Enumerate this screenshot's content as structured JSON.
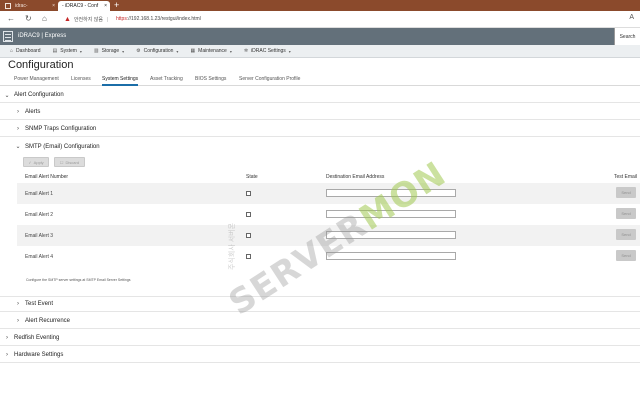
{
  "browser": {
    "tabs": [
      {
        "label": "idrac-",
        "close": "×"
      },
      {
        "label": "- iDRAC9 - Conf",
        "close": "×"
      }
    ],
    "new_tab": "+",
    "nav_icons": {
      "back": "←",
      "refresh": "↻",
      "home": "⌂"
    },
    "security_text": "안전하지 않음",
    "url_scheme": "https",
    "url_rest": "://192.168.1.23/restgui/index.html",
    "read_aloud": "A"
  },
  "idrac": {
    "product": "iDRAC9 | Express",
    "search_label": "Search",
    "nav": [
      {
        "label": "Dashboard",
        "icon": "home-icon",
        "glyph": "⌂",
        "dropdown": false
      },
      {
        "label": "System",
        "icon": "server-icon",
        "glyph": "▤",
        "dropdown": true
      },
      {
        "label": "Storage",
        "icon": "storage-icon",
        "glyph": "▥",
        "dropdown": true
      },
      {
        "label": "Configuration",
        "icon": "configuration-icon",
        "glyph": "⚙",
        "dropdown": true
      },
      {
        "label": "Maintenance",
        "icon": "maintenance-icon",
        "glyph": "▦",
        "dropdown": true
      },
      {
        "label": "iDRAC Settings",
        "icon": "settings-icon",
        "glyph": "✲",
        "dropdown": true
      }
    ]
  },
  "page": {
    "title": "Configuration",
    "subtabs": [
      {
        "label": "Power Management",
        "active": false
      },
      {
        "label": "Licenses",
        "active": false
      },
      {
        "label": "System Settings",
        "active": true
      },
      {
        "label": "Asset Tracking",
        "active": false
      },
      {
        "label": "BIOS Settings",
        "active": false
      },
      {
        "label": "Server Configuration Profile",
        "active": false
      }
    ]
  },
  "sections": {
    "alert_configuration": "Alert Configuration",
    "alerts": "Alerts",
    "snmp_traps": "SNMP Traps Configuration",
    "smtp": "SMTP (Email) Configuration",
    "test_event": "Test Event",
    "alert_recurrence": "Alert Recurrence",
    "redfish": "Redfish Eventing",
    "hardware": "Hardware Settings"
  },
  "smtp": {
    "apply_label": "Apply",
    "discard_label": "Discard",
    "columns": [
      "Email Alert Number",
      "State",
      "Destination Email Address",
      "Test Email"
    ],
    "rows": [
      {
        "name": "Email Alert 1",
        "email": "",
        "send": "Send"
      },
      {
        "name": "Email Alert 2",
        "email": "",
        "send": "Send"
      },
      {
        "name": "Email Alert 3",
        "email": "",
        "send": "Send"
      },
      {
        "name": "Email Alert 4",
        "email": "",
        "send": "Send"
      }
    ],
    "note": "Configure the SMTP server settings at SMTP Email Server Settings"
  },
  "watermark": {
    "main_a": "SERVER",
    "main_b": "MON",
    "sub": "주식회사 서버몬"
  }
}
